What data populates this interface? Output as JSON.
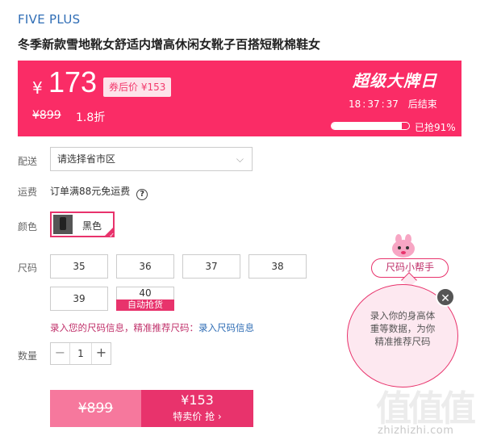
{
  "brand": "FIVE PLUS",
  "title": "冬季新款雪地靴女舒适内增高休闲女靴子百搭短靴棉鞋女",
  "banner": {
    "currency": "¥",
    "price": "173",
    "coupon_label": "券后价 ¥153",
    "original_price": "¥899",
    "discount": "1.8折",
    "event_title": "超级大牌日",
    "countdown": {
      "h": "18",
      "m": "37",
      "s": "37",
      "suffix": "后结束",
      "sep": ":"
    },
    "progress_percent": 91,
    "progress_text": "已抢91%"
  },
  "labels": {
    "delivery": "配送",
    "shipping": "运费",
    "color": "颜色",
    "size": "尺码",
    "quantity": "数量"
  },
  "delivery": {
    "placeholder": "请选择省市区"
  },
  "shipping": {
    "text": "订单满88元免运费",
    "help": "?"
  },
  "color": {
    "selected": "黑色"
  },
  "sizes": [
    {
      "label": "35"
    },
    {
      "label": "36"
    },
    {
      "label": "37"
    },
    {
      "label": "38"
    },
    {
      "label": "39"
    },
    {
      "label": "40",
      "tag": "自动抢货"
    }
  ],
  "size_tip": {
    "text": "录入您的尺码信息，精准推荐尺码：",
    "link": "录入尺码信息"
  },
  "quantity": {
    "minus": "−",
    "value": "1",
    "plus": "+"
  },
  "buy": {
    "old_price": "¥899",
    "price": "¥153",
    "action": "特卖价 抢 ›"
  },
  "helper": {
    "pill": "尺码小帮手",
    "bubble_lines": [
      "录入你的身高体",
      "重等数据，为你",
      "精准推荐尺码"
    ],
    "close": "✕"
  },
  "watermark": {
    "glyphs": "值值值",
    "text": "zhizhizhi.com"
  },
  "colors": {
    "accent": "#fa2c66",
    "pink": "#e8336c",
    "link": "#2f6db5"
  }
}
